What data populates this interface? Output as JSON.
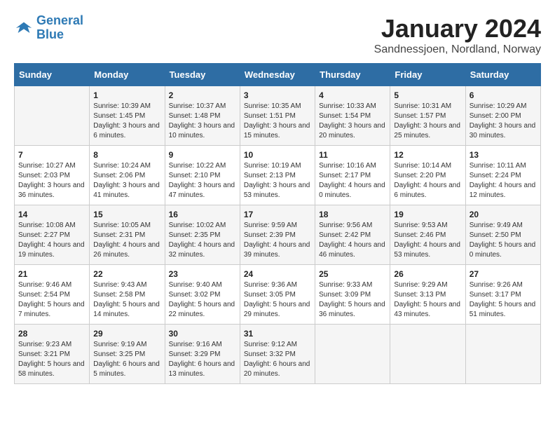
{
  "logo": {
    "line1": "General",
    "line2": "Blue"
  },
  "title": "January 2024",
  "subtitle": "Sandnessjoen, Nordland, Norway",
  "days": [
    "Sunday",
    "Monday",
    "Tuesday",
    "Wednesday",
    "Thursday",
    "Friday",
    "Saturday"
  ],
  "weeks": [
    [
      {
        "date": "",
        "info": ""
      },
      {
        "date": "1",
        "info": "Sunrise: 10:39 AM\nSunset: 1:45 PM\nDaylight: 3 hours\nand 6 minutes."
      },
      {
        "date": "2",
        "info": "Sunrise: 10:37 AM\nSunset: 1:48 PM\nDaylight: 3 hours\nand 10 minutes."
      },
      {
        "date": "3",
        "info": "Sunrise: 10:35 AM\nSunset: 1:51 PM\nDaylight: 3 hours\nand 15 minutes."
      },
      {
        "date": "4",
        "info": "Sunrise: 10:33 AM\nSunset: 1:54 PM\nDaylight: 3 hours\nand 20 minutes."
      },
      {
        "date": "5",
        "info": "Sunrise: 10:31 AM\nSunset: 1:57 PM\nDaylight: 3 hours\nand 25 minutes."
      },
      {
        "date": "6",
        "info": "Sunrise: 10:29 AM\nSunset: 2:00 PM\nDaylight: 3 hours\nand 30 minutes."
      }
    ],
    [
      {
        "date": "7",
        "info": "Sunrise: 10:27 AM\nSunset: 2:03 PM\nDaylight: 3 hours\nand 36 minutes."
      },
      {
        "date": "8",
        "info": "Sunrise: 10:24 AM\nSunset: 2:06 PM\nDaylight: 3 hours\nand 41 minutes."
      },
      {
        "date": "9",
        "info": "Sunrise: 10:22 AM\nSunset: 2:10 PM\nDaylight: 3 hours\nand 47 minutes."
      },
      {
        "date": "10",
        "info": "Sunrise: 10:19 AM\nSunset: 2:13 PM\nDaylight: 3 hours\nand 53 minutes."
      },
      {
        "date": "11",
        "info": "Sunrise: 10:16 AM\nSunset: 2:17 PM\nDaylight: 4 hours\nand 0 minutes."
      },
      {
        "date": "12",
        "info": "Sunrise: 10:14 AM\nSunset: 2:20 PM\nDaylight: 4 hours\nand 6 minutes."
      },
      {
        "date": "13",
        "info": "Sunrise: 10:11 AM\nSunset: 2:24 PM\nDaylight: 4 hours\nand 12 minutes."
      }
    ],
    [
      {
        "date": "14",
        "info": "Sunrise: 10:08 AM\nSunset: 2:27 PM\nDaylight: 4 hours\nand 19 minutes."
      },
      {
        "date": "15",
        "info": "Sunrise: 10:05 AM\nSunset: 2:31 PM\nDaylight: 4 hours\nand 26 minutes."
      },
      {
        "date": "16",
        "info": "Sunrise: 10:02 AM\nSunset: 2:35 PM\nDaylight: 4 hours\nand 32 minutes."
      },
      {
        "date": "17",
        "info": "Sunrise: 9:59 AM\nSunset: 2:39 PM\nDaylight: 4 hours\nand 39 minutes."
      },
      {
        "date": "18",
        "info": "Sunrise: 9:56 AM\nSunset: 2:42 PM\nDaylight: 4 hours\nand 46 minutes."
      },
      {
        "date": "19",
        "info": "Sunrise: 9:53 AM\nSunset: 2:46 PM\nDaylight: 4 hours\nand 53 minutes."
      },
      {
        "date": "20",
        "info": "Sunrise: 9:49 AM\nSunset: 2:50 PM\nDaylight: 5 hours\nand 0 minutes."
      }
    ],
    [
      {
        "date": "21",
        "info": "Sunrise: 9:46 AM\nSunset: 2:54 PM\nDaylight: 5 hours\nand 7 minutes."
      },
      {
        "date": "22",
        "info": "Sunrise: 9:43 AM\nSunset: 2:58 PM\nDaylight: 5 hours\nand 14 minutes."
      },
      {
        "date": "23",
        "info": "Sunrise: 9:40 AM\nSunset: 3:02 PM\nDaylight: 5 hours\nand 22 minutes."
      },
      {
        "date": "24",
        "info": "Sunrise: 9:36 AM\nSunset: 3:05 PM\nDaylight: 5 hours\nand 29 minutes."
      },
      {
        "date": "25",
        "info": "Sunrise: 9:33 AM\nSunset: 3:09 PM\nDaylight: 5 hours\nand 36 minutes."
      },
      {
        "date": "26",
        "info": "Sunrise: 9:29 AM\nSunset: 3:13 PM\nDaylight: 5 hours\nand 43 minutes."
      },
      {
        "date": "27",
        "info": "Sunrise: 9:26 AM\nSunset: 3:17 PM\nDaylight: 5 hours\nand 51 minutes."
      }
    ],
    [
      {
        "date": "28",
        "info": "Sunrise: 9:23 AM\nSunset: 3:21 PM\nDaylight: 5 hours\nand 58 minutes."
      },
      {
        "date": "29",
        "info": "Sunrise: 9:19 AM\nSunset: 3:25 PM\nDaylight: 6 hours\nand 5 minutes."
      },
      {
        "date": "30",
        "info": "Sunrise: 9:16 AM\nSunset: 3:29 PM\nDaylight: 6 hours\nand 13 minutes."
      },
      {
        "date": "31",
        "info": "Sunrise: 9:12 AM\nSunset: 3:32 PM\nDaylight: 6 hours\nand 20 minutes."
      },
      {
        "date": "",
        "info": ""
      },
      {
        "date": "",
        "info": ""
      },
      {
        "date": "",
        "info": ""
      }
    ]
  ]
}
